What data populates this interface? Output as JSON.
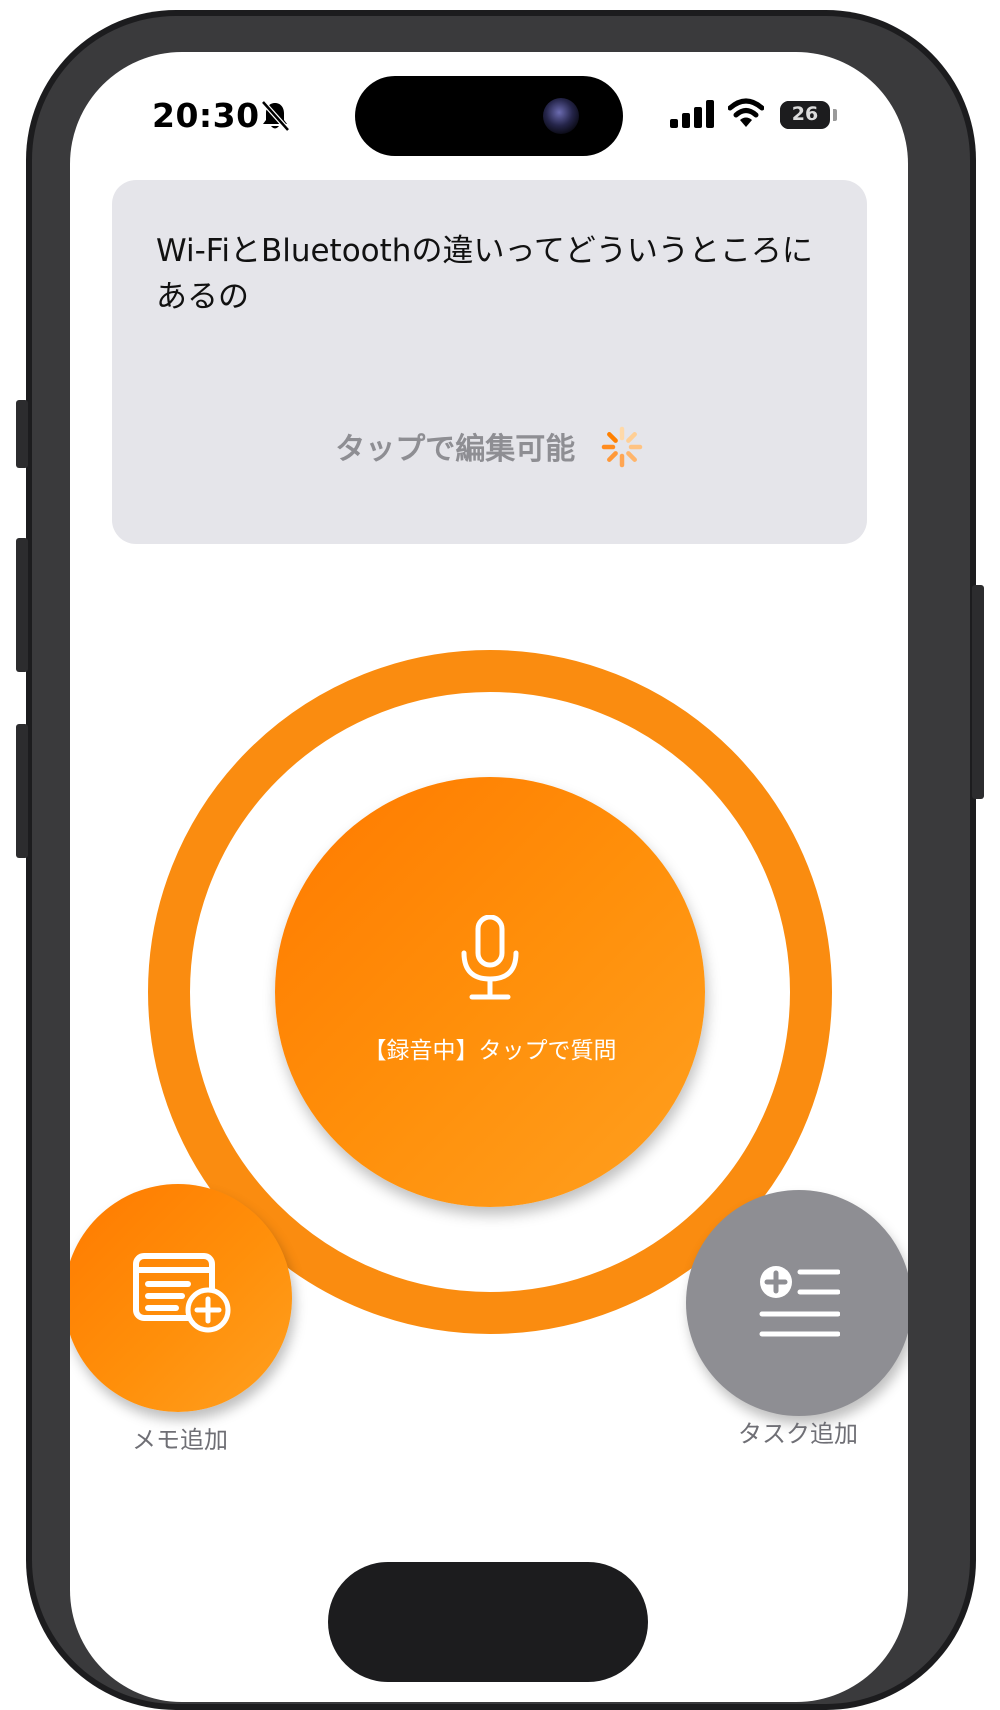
{
  "status_bar": {
    "time": "20:30",
    "battery_level": "26",
    "icons": [
      "bell-slash-icon",
      "cellular-signal-icon",
      "wifi-icon",
      "battery-icon"
    ]
  },
  "question_card": {
    "text": "Wi-FiとBluetoothの違いってどういうところにあるの",
    "edit_hint": "タップで編集可能",
    "spinner_icon": "loading-spinner-icon"
  },
  "mic_button": {
    "icon": "microphone-icon",
    "label": "【録音中】タップで質問"
  },
  "memo_button": {
    "icon": "memo-add-icon",
    "label": "メモ追加"
  },
  "task_button": {
    "icon": "task-add-icon",
    "label": "タスク追加"
  },
  "colors": {
    "accent_orange": "#fa8c10",
    "gradient_start": "#ff7a00",
    "gradient_end": "#ffa020",
    "task_gray": "#8e8e93",
    "card_bg": "#e5e5ea"
  }
}
